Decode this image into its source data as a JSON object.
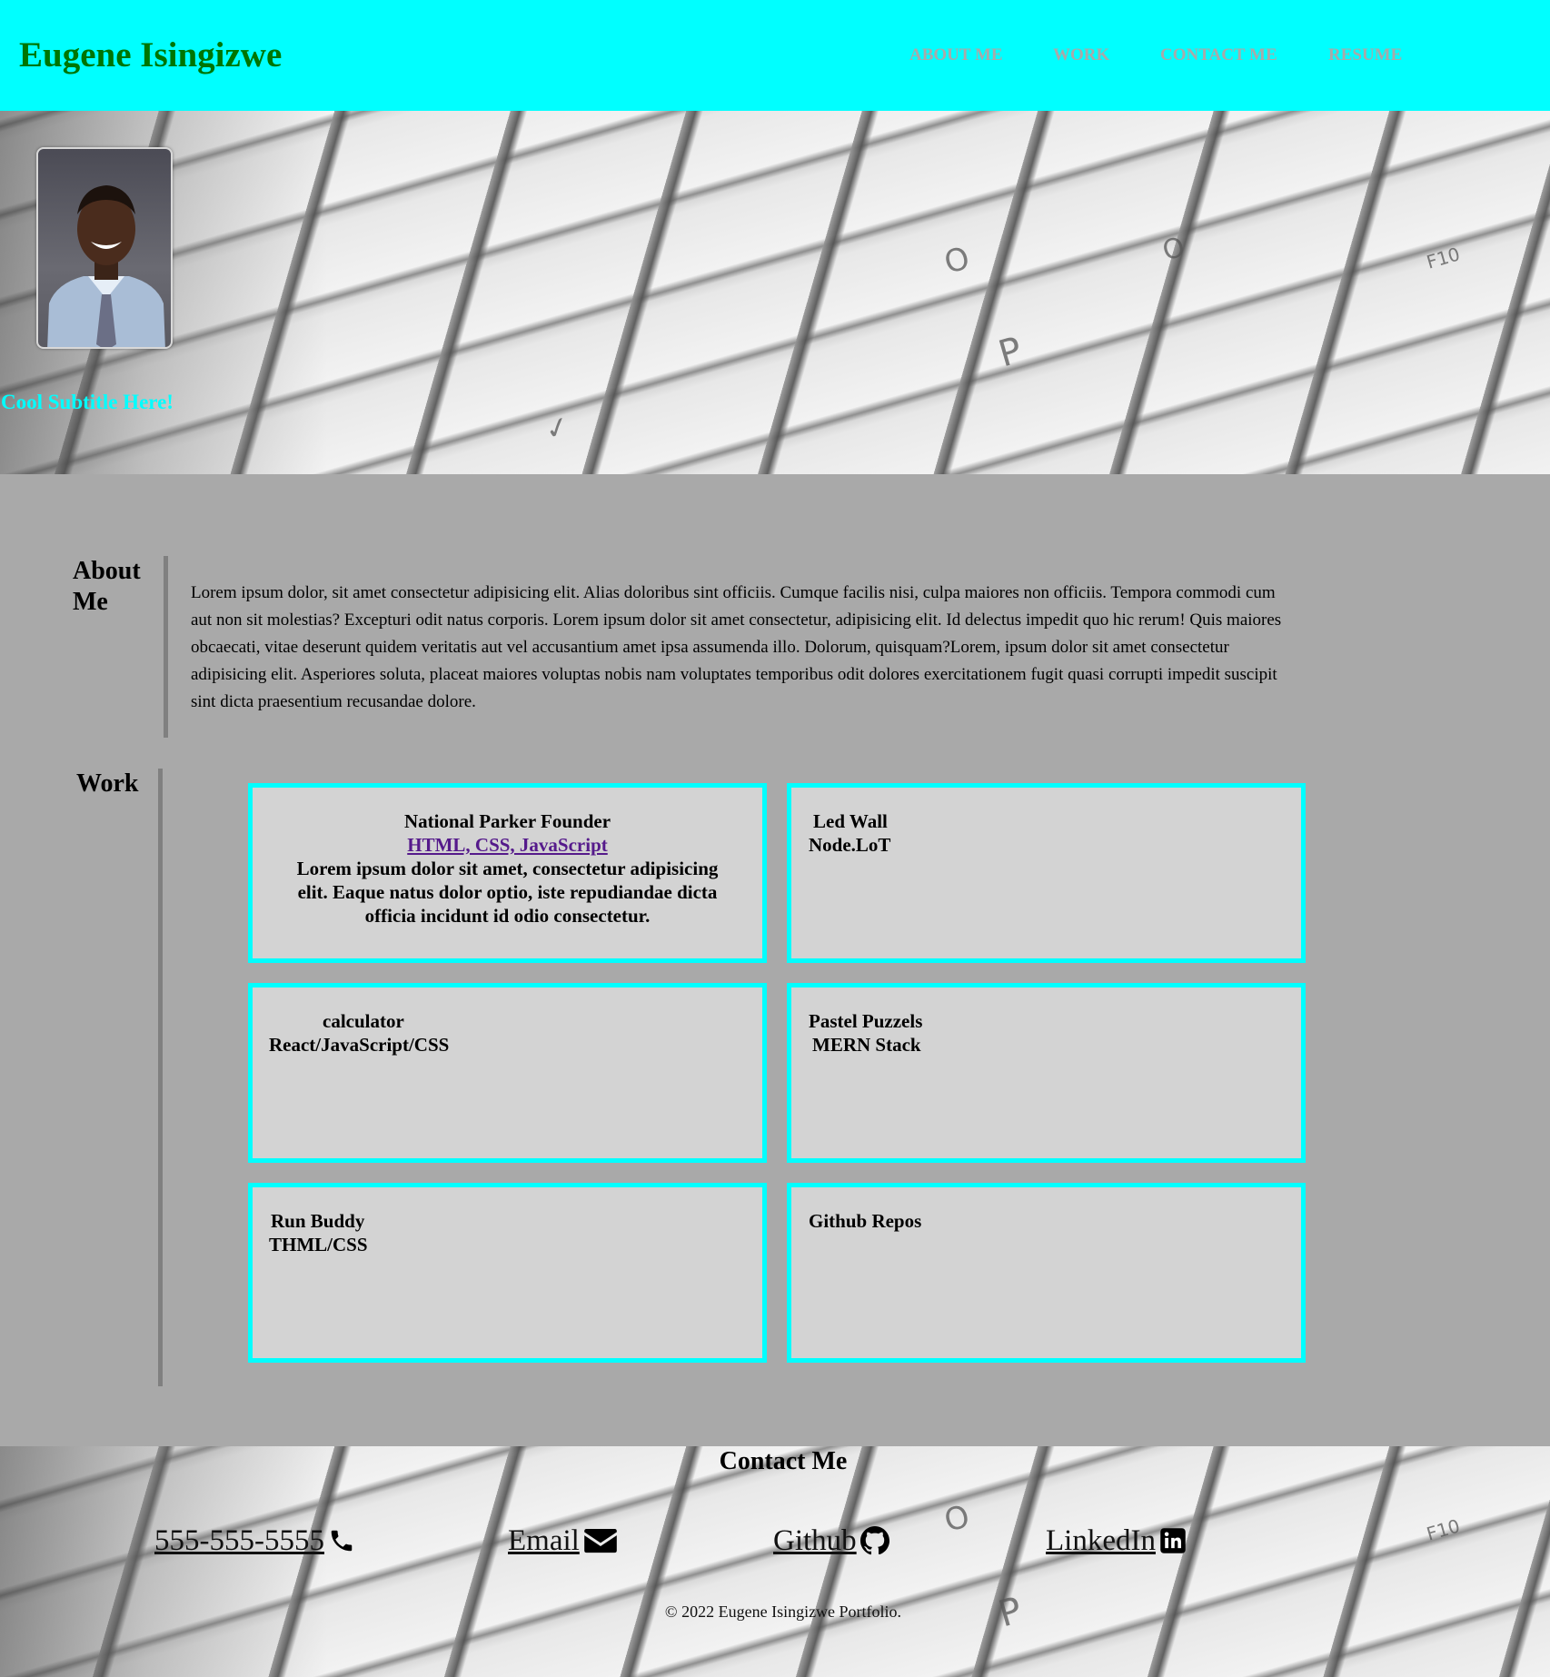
{
  "header": {
    "title": "Eugene Isingizwe",
    "nav": [
      "ABOUT ME",
      "WORK",
      "CONTACT ME",
      "RESUME"
    ]
  },
  "hero": {
    "subtitle": "Cool Subtitle Here!",
    "avatar": "profile-photo"
  },
  "about": {
    "heading_line1": "About",
    "heading_line2": "Me",
    "text": "Lorem ipsum dolor, sit amet consectetur adipisicing elit. Alias doloribus sint officiis. Cumque facilis nisi, culpa maiores non officiis. Tempora commodi cum aut non sit molestias? Excepturi odit natus corporis. Lorem ipsum dolor sit amet consectetur, adipisicing elit. Id delectus impedit quo hic rerum! Quis maiores obcaecati, vitae deserunt quidem veritatis aut vel accusantium amet ipsa assumenda illo. Dolorum, quisquam?Lorem, ipsum dolor sit amet consectetur adipisicing elit. Asperiores soluta, placeat maiores voluptas nobis nam voluptates temporibus odit dolores exercitationem fugit quasi corrupti impedit suscipit sint dicta praesentium recusandae dolore."
  },
  "work": {
    "heading": "Work",
    "projects": [
      {
        "title": "National Parker Founder",
        "tech": "HTML, CSS, JavaScript",
        "description": "Lorem ipsum dolor sit amet, consectetur adipisicing elit. Eaque natus dolor optio, iste repudiandae dicta officia incidunt id odio consectetur."
      },
      {
        "title": "Led Wall",
        "tech": "Node.LoT"
      },
      {
        "title": "calculator",
        "tech": "React/JavaScript/CSS"
      },
      {
        "title": "Pastel Puzzels",
        "tech": "MERN Stack"
      },
      {
        "title": "Run Buddy",
        "tech": "THML/CSS"
      },
      {
        "title": "Github Repos"
      }
    ]
  },
  "contact": {
    "heading": "Contact Me",
    "phone": "555-555-5555",
    "email": "Email",
    "github": "Github",
    "linkedin": "LinkedIn",
    "icons": [
      "phone-icon",
      "envelope-icon",
      "github-icon",
      "linkedin-icon"
    ]
  },
  "footer": {
    "copyright": "© 2022 Eugene Isingizwe Portfolio."
  },
  "colors": {
    "header_bg": "#00ffff",
    "title": "#007500",
    "nav": "#a9a9a9",
    "page_bg": "#a9a9a9",
    "card_bg": "#d3d3d3",
    "card_border": "#00ffff",
    "link": "#551a8b"
  }
}
